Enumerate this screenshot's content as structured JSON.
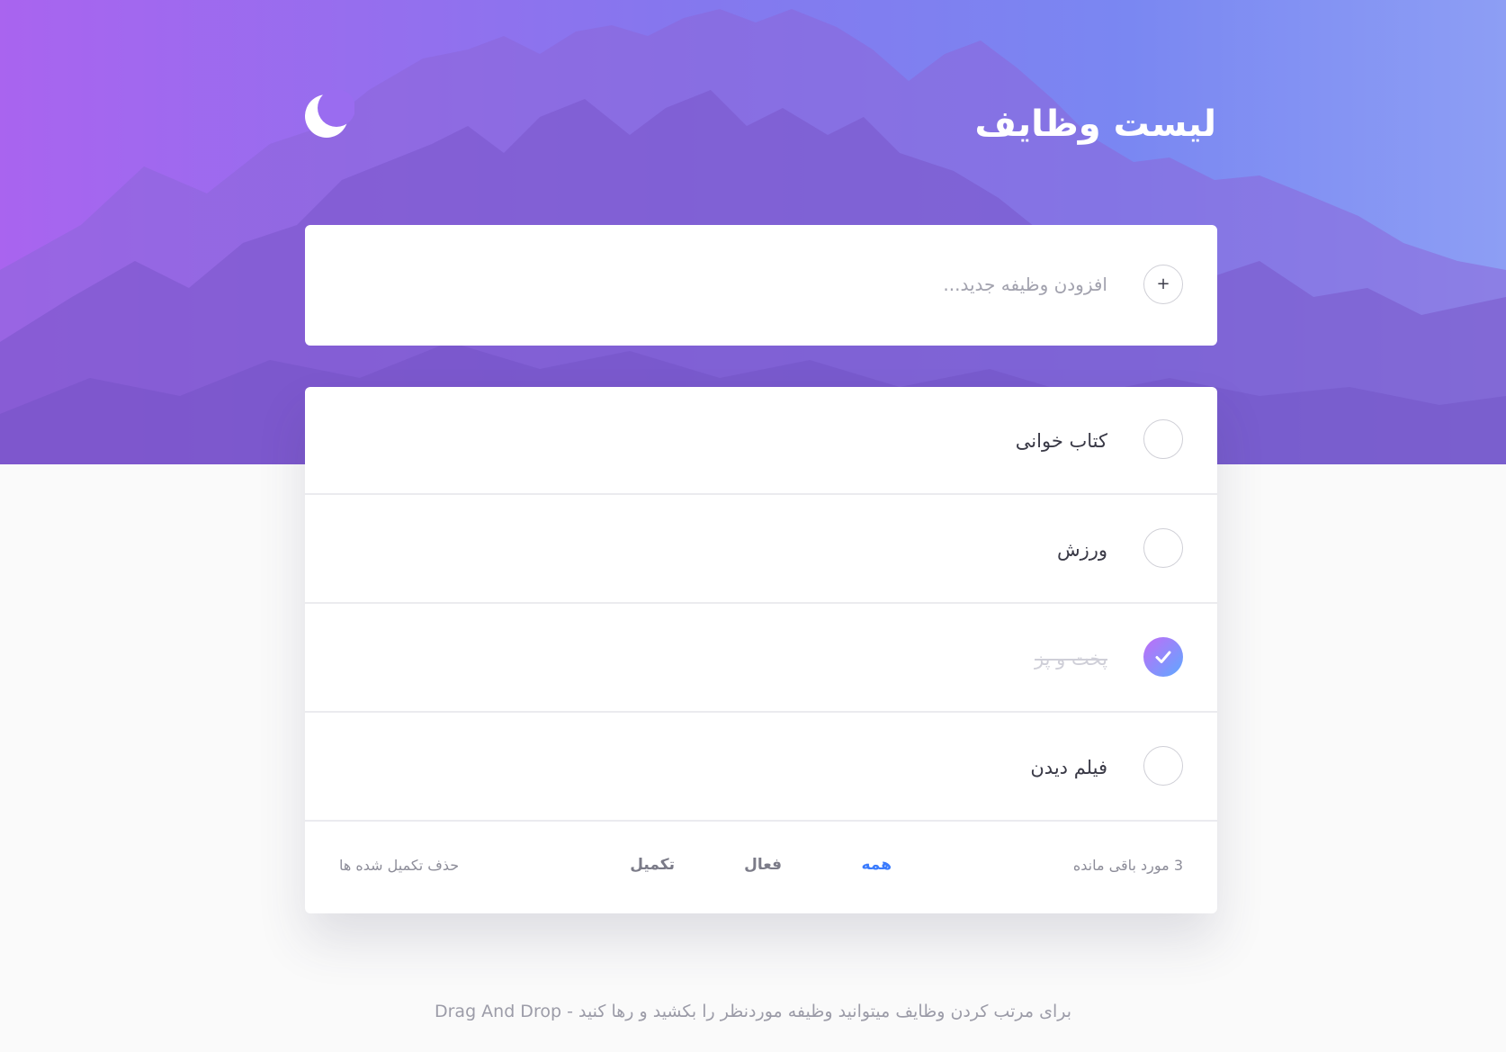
{
  "header": {
    "title": "لیست وظایف",
    "theme_icon": "moon-icon"
  },
  "new_todo": {
    "placeholder": "افزودن وظیفه جدید...",
    "add_symbol": "+",
    "add_icon": "plus-icon"
  },
  "todos": [
    {
      "text": "کتاب خوانی",
      "completed": false
    },
    {
      "text": "ورزش",
      "completed": false
    },
    {
      "text": "پخت و پز",
      "completed": true
    },
    {
      "text": "فیلم دیدن",
      "completed": false
    }
  ],
  "footer": {
    "items_left": "3 مورد باقی مانده",
    "filters": {
      "all": "همه",
      "active": "فعال",
      "completed": "تکمیل"
    },
    "selected_filter": "all",
    "clear_completed": "حذف تکمیل شده ها"
  },
  "hint": "برای مرتب کردن وظایف میتوانید وظیفه موردنظر را بکشید و رها کنید - Drag And Drop",
  "colors": {
    "hero_gradient_start": "#a964ef",
    "hero_gradient_end": "#8d9ef4",
    "check_gradient_start": "#c16cf7",
    "check_gradient_end": "#5ea9ff",
    "active_filter": "#3a7bfd",
    "page_background": "#fafafa"
  }
}
